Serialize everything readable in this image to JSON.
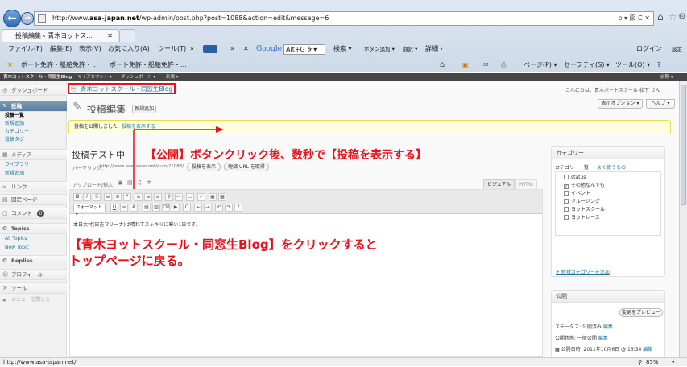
{
  "browser": {
    "url": "http://www.asa-japan.net/wp-admin/post.php?post=1088&action=edit&message=6",
    "url_host": "asa-japan.net",
    "search_controls": "ρ ▾ 図 C ✕",
    "tab_label": "投稿編集 ‹ 青木ヨットス...",
    "tab_close": "✕",
    "menu": [
      "ファイル(F)",
      "編集(E)",
      "表示(V)",
      "お気に入り(A)",
      "ツール(T)"
    ],
    "more": "»",
    "google_label": "Google",
    "google_search": "Alt+G を▾",
    "search_btn": "検索 ▾",
    "add_button": "ボタン追加 ▾",
    "translate": "翻訳 ▾",
    "detail": "詳細 ›",
    "login": "ログイン",
    "settings": "設定",
    "favorites": [
      "ボート免許・船舶免許・...",
      "ボート免許・船舶免許・..."
    ],
    "commands": [
      "ページ(P) ▾",
      "セーフティ(S) ▾",
      "ツール(O) ▾"
    ],
    "status_url": "http://www.asa-japan.net/",
    "zoom": "85%",
    "accent": "#2d69b5"
  },
  "wp_admin_bar": {
    "items": [
      "青木ヨットスクール・同窓生Blog",
      "マイアカウント ▾",
      "ダッシュボード ▾",
      "新規 ▾"
    ],
    "right": "前期 ▾"
  },
  "sidebar": {
    "dashboard": "ダッシュボード",
    "posts": "投稿",
    "posts_sub": [
      "投稿一覧",
      "新規追加",
      "カテゴリー",
      "投稿タグ"
    ],
    "media": "メディア",
    "media_sub": [
      "ライブラリ",
      "新規追加"
    ],
    "links": "リンク",
    "pages": "固定ページ",
    "comments": "コメント",
    "comments_count": "0",
    "topics": "Topics",
    "topics_sub": [
      "All Topics",
      "New Topic"
    ],
    "replies": "Replies",
    "profile": "プロフィール",
    "tools": "ツール",
    "collapse": "メニューを閉じる"
  },
  "header": {
    "site_link": "青木ヨットスクール・同窓生Blog",
    "greeting": "こんにちは、青木ボートスクール 松下 さん",
    "display_options": "表示オプション ▾",
    "help": "ヘルプ ▾",
    "page_title": "投稿編集",
    "new_button": "新規追加"
  },
  "notice": {
    "text": "投稿を公開しました",
    "link": "投稿を表示する"
  },
  "editor": {
    "post_title": "投稿テスト中",
    "permalink_label": "パーマリンク:",
    "permalink_url": "http://www.asa-japan.net/outo/?1088/",
    "view_button": "投稿を表示",
    "shortlink_button": "短縮 URL を取得",
    "upload_label": "アップロード/挿入",
    "visual_tab": "ビジュアル",
    "html_tab": "HTML",
    "format_label": "フォーマット",
    "body_text": "本日大村(日吉マリーナ)は晴れてスッキリに寒い1日です。"
  },
  "categories": {
    "title": "カテゴリー",
    "tab_all": "カテゴリー一覧",
    "tab_popular": "よく使うもの",
    "items": [
      {
        "label": "status",
        "checked": false
      },
      {
        "label": "その他なんでも",
        "checked": true
      },
      {
        "label": "イベント",
        "checked": false
      },
      {
        "label": "クルージング",
        "checked": false
      },
      {
        "label": "ヨットスクール",
        "checked": false
      },
      {
        "label": "ヨットレース",
        "checked": false
      }
    ],
    "add_link": "+ 新規カテゴリーを追加"
  },
  "publish": {
    "title": "公開",
    "preview_button": "変更をプレビュー",
    "status": "ステータス: 公開済み",
    "status_edit": "編集",
    "visibility": "公開状態: 一般公開",
    "visibility_edit": "編集",
    "date": "公開日時: 2011年10月6日 @ 16:34",
    "date_edit": "編集"
  },
  "annotations": {
    "top": "【公開】ボタンクリック後、数秒で【投稿を表示する】",
    "bottom_line1": "【青木ヨットスクール・同窓生Blog】をクリックすると",
    "bottom_line2": "トップページに戻る。",
    "color": "#e8101a"
  }
}
